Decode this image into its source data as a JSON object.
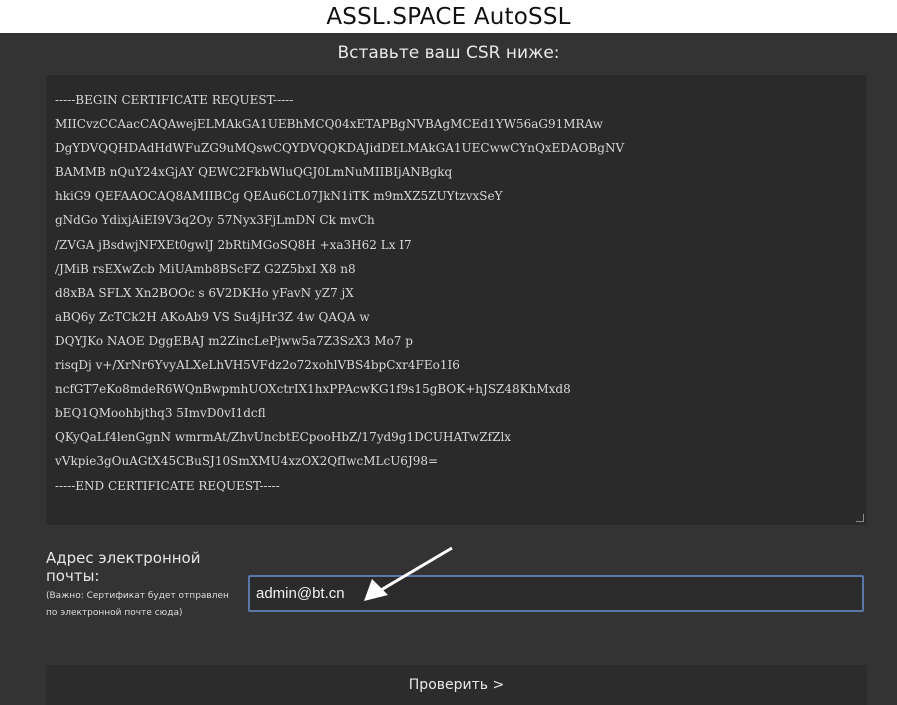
{
  "header": {
    "title": "ASSL.SPACE AutoSSL"
  },
  "csr": {
    "heading": "Вставьте ваш CSR ниже:",
    "lines": [
      "-----BEGIN CERTIFICATE REQUEST-----",
      "MIICvzCCAacCAQAwejELMAkGA1UEBhMCQ04xETAPBgNVBAgMCEd1YW56aG91MRAw",
      "DgYDVQQHDAdHdWFuZG9uMQswCQYDVQQKDAJidDELMAkGA1UECwwCYnQxEDAOBgNV",
      "BAMMB    nQuY24xGjAY      QEWC2FkbWluQGJ0LmNuMIIBIjANBgkq",
      "hkiG9    QEFAAOCAQ8AMIIBCg   QEAu6CL07JkN1iTK       m9mXZ5ZUYtzvxSeY",
      "gNdGo    YdixjAiEI9V3q2Oy    57Nyx3FjLmDN        Ck         mvCh",
      "/ZVGA    jBsdwjNFXEt0gwlJ    2bRtiMGoSQ8H    +xa3H62     Lx     I7",
      "/JMiB    rsEXwZcb    MiUAmb8BScFZ     G2Z5bxI     X8     n8",
      "d8xBA     SFLX      Xn2BOOc    s     6V2DKHo     yFavN     yZ7    jX",
      "aBQ6y     ZcTCk2H    AKoAb9     VS     Su4jHr3Z      4w    QAQA    w",
      "DQYJKo     NAOE    DggEBAJ      m2ZincLePjww5a7Z3SzX3      Mo7     p",
      "risqDj          v+/XrNr6YvyALXeLhVH5VFdz2o72xohlVBS4bpCxr4FEo1I6",
      "ncfGT7eKo8mdeR6WQnBwpmhUOXctrIX1hxPPAcwKG1f9s15gBOK+hJSZ48KhMxd8",
      "bEQ1QMoohbjthq3                              5ImvD0vI1dcfl",
      "QKyQaLf4lenGgnN    wmrmAt/ZhvUncbtECpooHbZ/17yd9g1DCUHATwZfZlx",
      "vVkpie3gOuAGtX45CBuSJ10SmXMU4xzOX2QfIwcMLcU6J98=",
      "-----END CERTIFICATE REQUEST-----"
    ]
  },
  "email": {
    "label": "Адрес электронной почты:",
    "note": "(Важно: Сертификат будет отправлен по электронной почте сюда)",
    "value": "admin@bt.cn"
  },
  "submit": {
    "label": "Проверить >"
  }
}
